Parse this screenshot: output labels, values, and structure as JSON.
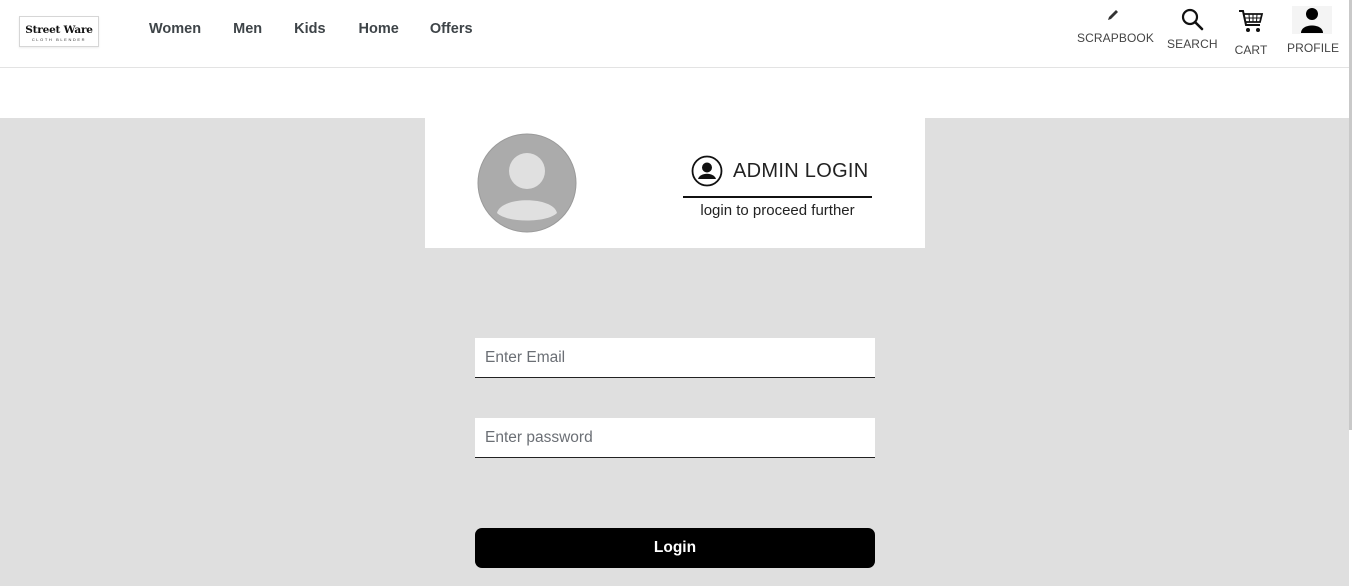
{
  "brand": {
    "name": "Street Ware",
    "tagline": "CLOTH BLENDER"
  },
  "nav": {
    "items": [
      {
        "label": "Women"
      },
      {
        "label": "Men"
      },
      {
        "label": "Kids"
      },
      {
        "label": "Home"
      },
      {
        "label": "Offers"
      }
    ]
  },
  "header_icons": {
    "scrapbook": {
      "label": "SCRAPBOOK",
      "icon": "pencil-icon"
    },
    "search": {
      "label": "SEARCH",
      "icon": "search-icon"
    },
    "cart": {
      "label": "CART",
      "icon": "cart-icon"
    },
    "profile": {
      "label": "PROFILE",
      "icon": "user-icon"
    }
  },
  "login_card": {
    "title": "ADMIN LOGIN",
    "subtitle": "login to proceed further"
  },
  "form": {
    "email_placeholder": "Enter Email",
    "password_placeholder": "Enter password",
    "submit_label": "Login"
  },
  "colors": {
    "background": "#dfdfdf",
    "button": "#000000",
    "avatar": "#ababab"
  }
}
